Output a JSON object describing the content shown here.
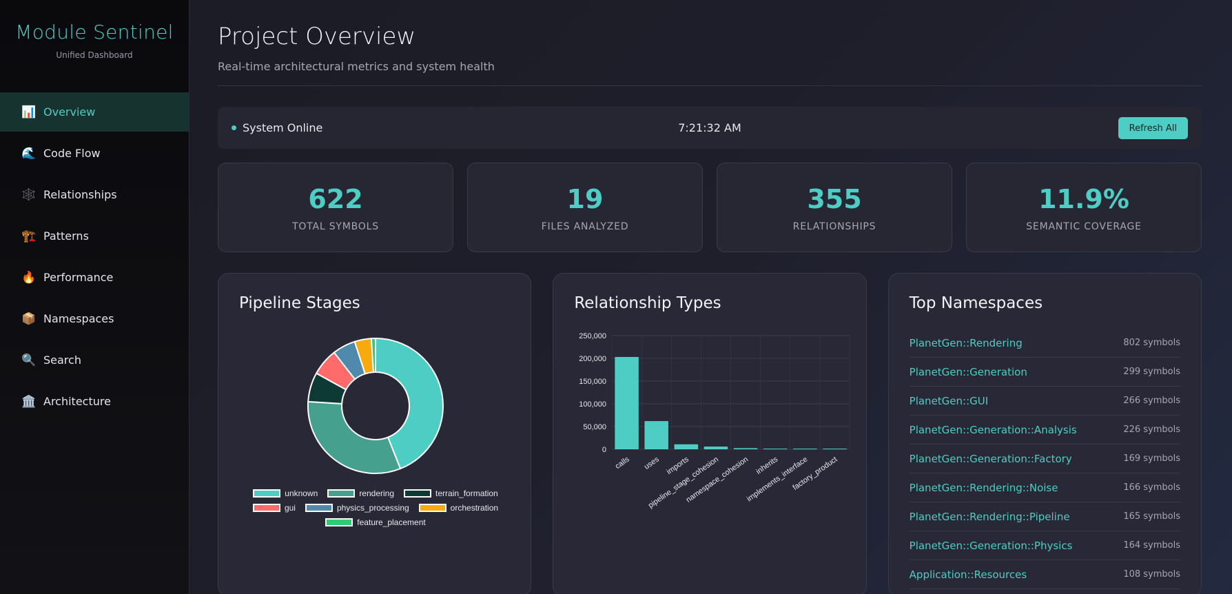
{
  "brand": {
    "title": "Module Sentinel",
    "subtitle": "Unified Dashboard"
  },
  "nav": [
    {
      "label": "Overview",
      "icon": "📊",
      "icon_name": "bar-chart-icon",
      "active": true
    },
    {
      "label": "Code Flow",
      "icon": "🌊",
      "icon_name": "wave-icon"
    },
    {
      "label": "Relationships",
      "icon": "🕸️",
      "icon_name": "web-icon"
    },
    {
      "label": "Patterns",
      "icon": "🏗️",
      "icon_name": "construction-icon"
    },
    {
      "label": "Performance",
      "icon": "🔥",
      "icon_name": "fire-icon"
    },
    {
      "label": "Namespaces",
      "icon": "📦",
      "icon_name": "package-icon"
    },
    {
      "label": "Search",
      "icon": "🔍",
      "icon_name": "search-icon"
    },
    {
      "label": "Architecture",
      "icon": "🏛️",
      "icon_name": "classical-building-icon"
    }
  ],
  "header": {
    "title": "Project Overview",
    "subtitle": "Real-time architectural metrics and system health"
  },
  "status": {
    "text": "System Online",
    "time": "7:21:32 AM",
    "refresh_label": "Refresh All"
  },
  "stats": [
    {
      "value": "622",
      "label": "TOTAL SYMBOLS"
    },
    {
      "value": "19",
      "label": "FILES ANALYZED"
    },
    {
      "value": "355",
      "label": "RELATIONSHIPS"
    },
    {
      "value": "11.9%",
      "label": "SEMANTIC COVERAGE"
    }
  ],
  "panels": {
    "pipeline_title": "Pipeline Stages",
    "relationship_title": "Relationship Types",
    "namespaces_title": "Top Namespaces"
  },
  "colors": {
    "accent": "#4ecdc4",
    "unknown": "#4ecdc4",
    "rendering": "#45a08e",
    "terrain_formation": "#0e3a36",
    "gui": "#ff6b6b",
    "physics_processing": "#4f89ab",
    "orchestration": "#f7a90e",
    "feature_placement": "#2ecc71"
  },
  "chart_data": [
    {
      "type": "pie",
      "variant": "doughnut",
      "labels": [
        "unknown",
        "rendering",
        "terrain_formation",
        "gui",
        "physics_processing",
        "orchestration",
        "feature_placement"
      ],
      "values": [
        44,
        32,
        7,
        6.5,
        5.5,
        4,
        1
      ],
      "legend": "bottom"
    },
    {
      "type": "bar",
      "categories": [
        "calls",
        "uses",
        "imports",
        "pipeline_stage_cohesion",
        "namespace_cohesion",
        "inherits",
        "implements_interface",
        "factory_product"
      ],
      "values": [
        203000,
        62000,
        11000,
        6000,
        2500,
        900,
        600,
        400
      ],
      "ylim": [
        0,
        250000
      ],
      "yticks": [
        "0",
        "50,000",
        "100,000",
        "150,000",
        "200,000",
        "250,000"
      ],
      "grid": true
    }
  ],
  "namespaces": [
    {
      "name": "PlanetGen::Rendering",
      "count": "802 symbols"
    },
    {
      "name": "PlanetGen::Generation",
      "count": "299 symbols"
    },
    {
      "name": "PlanetGen::GUI",
      "count": "266 symbols"
    },
    {
      "name": "PlanetGen::Generation::Analysis",
      "count": "226 symbols"
    },
    {
      "name": "PlanetGen::Generation::Factory",
      "count": "169 symbols"
    },
    {
      "name": "PlanetGen::Rendering::Noise",
      "count": "166 symbols"
    },
    {
      "name": "PlanetGen::Rendering::Pipeline",
      "count": "165 symbols"
    },
    {
      "name": "PlanetGen::Generation::Physics",
      "count": "164 symbols"
    },
    {
      "name": "Application::Resources",
      "count": "108 symbols"
    }
  ]
}
